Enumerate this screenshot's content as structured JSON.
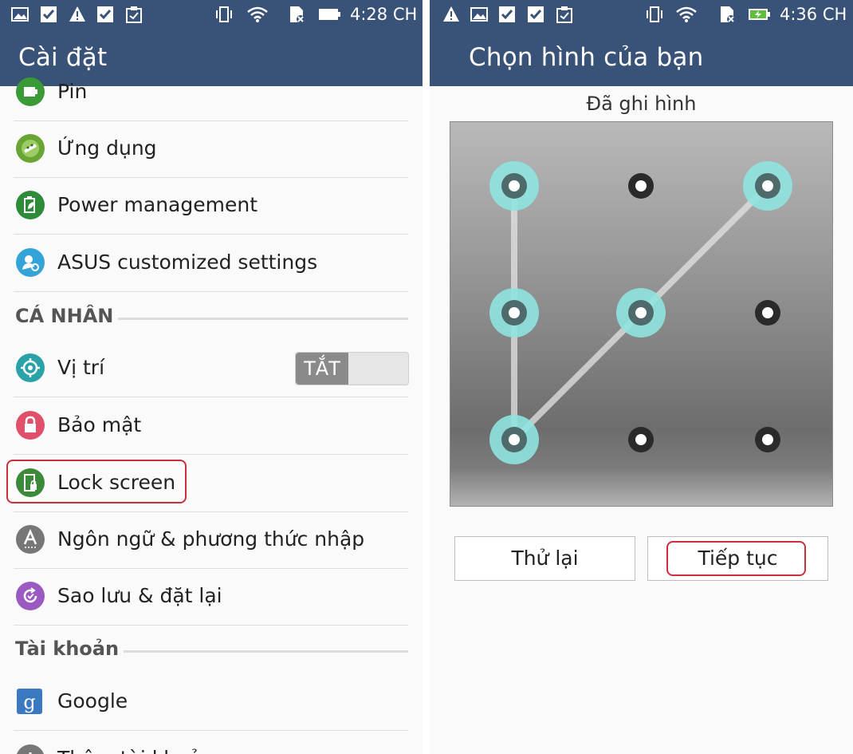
{
  "left": {
    "statusbar": {
      "time": "4:28 CH"
    },
    "title": "Cài đặt",
    "items_top": [
      {
        "label": "Pin",
        "icon": "battery-icon",
        "color": "#3a9a35"
      },
      {
        "label": "Ứng dụng",
        "icon": "android-icon",
        "color": "#6aa534"
      },
      {
        "label": "Power management",
        "icon": "power-leaf-icon",
        "color": "#2e8b3a"
      },
      {
        "label": "ASUS customized settings",
        "icon": "asus-settings-icon",
        "color": "#34a3d8"
      }
    ],
    "section_personal": "CÁ NHÂN",
    "items_personal": [
      {
        "label": "Vị trí",
        "icon": "location-icon",
        "color": "#2aa3a8"
      },
      {
        "label": "Bảo mật",
        "icon": "lock-icon",
        "color": "#e0506b"
      },
      {
        "label": "Lock screen",
        "icon": "lock-screen-icon",
        "color": "#3a8a3a"
      },
      {
        "label": "Ngôn ngữ & phương thức nhập",
        "icon": "language-icon",
        "color": "#777777"
      },
      {
        "label": "Sao lưu & đặt lại",
        "icon": "backup-icon",
        "color": "#9b59c2"
      }
    ],
    "location_toggle": "TẮT",
    "section_accounts": "Tài khoản",
    "items_accounts": [
      {
        "label": "Google",
        "icon": "google-icon",
        "color": "#3b78c2"
      },
      {
        "label": "Thêm tài khoản",
        "icon": "add-account-icon",
        "color": "#777777"
      }
    ]
  },
  "right": {
    "statusbar": {
      "time": "4:36 CH"
    },
    "title": "Chọn hình của bạn",
    "subtitle": "Đã ghi hình",
    "pattern": {
      "selected_dots": [
        1,
        3,
        4,
        5,
        7
      ],
      "path_order": [
        1,
        4,
        7,
        5,
        3
      ]
    },
    "retry_label": "Thử lại",
    "continue_label": "Tiếp tục"
  },
  "colors": {
    "appbar": "#395378",
    "highlight": "#cc2f3c",
    "dot_ring": "#8fe3e0"
  }
}
